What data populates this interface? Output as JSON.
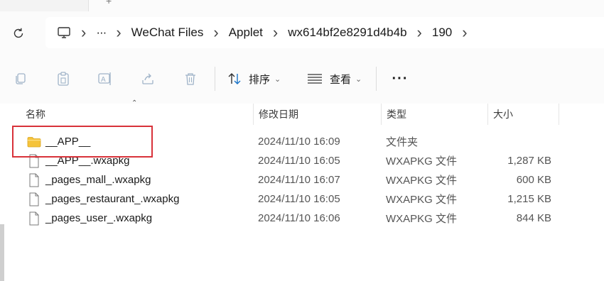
{
  "tabstrip": {
    "fragment_glyph": "+"
  },
  "addressbar": {
    "breadcrumbs": [
      {
        "kind": "icon",
        "icon": "computer-icon"
      },
      {
        "kind": "overflow",
        "label": "···"
      },
      {
        "kind": "text",
        "label": "WeChat Files"
      },
      {
        "kind": "text",
        "label": "Applet"
      },
      {
        "kind": "text",
        "label": "wx614bf2e8291d4b4b"
      },
      {
        "kind": "text",
        "label": "190"
      }
    ]
  },
  "toolbar": {
    "sort_label": "排序",
    "view_label": "查看",
    "more_label": "···"
  },
  "columns": {
    "name": "名称",
    "modified": "修改日期",
    "type": "类型",
    "size": "大小"
  },
  "files": [
    {
      "name": "__APP__",
      "modified": "2024/11/10 16:09",
      "type": "文件夹",
      "size": "",
      "icon": "folder-icon"
    },
    {
      "name": "__APP__.wxapkg",
      "modified": "2024/11/10 16:05",
      "type": "WXAPKG 文件",
      "size": "1,287 KB",
      "icon": "file-icon"
    },
    {
      "name": "_pages_mall_.wxapkg",
      "modified": "2024/11/10 16:07",
      "type": "WXAPKG 文件",
      "size": "600 KB",
      "icon": "file-icon"
    },
    {
      "name": "_pages_restaurant_.wxapkg",
      "modified": "2024/11/10 16:05",
      "type": "WXAPKG 文件",
      "size": "1,215 KB",
      "icon": "file-icon"
    },
    {
      "name": "_pages_user_.wxapkg",
      "modified": "2024/11/10 16:06",
      "type": "WXAPKG 文件",
      "size": "844 KB",
      "icon": "file-icon"
    }
  ],
  "colors": {
    "highlight": "#d8323a",
    "folder": "#f5c33b",
    "chrome_bg": "#fbfbfb"
  }
}
